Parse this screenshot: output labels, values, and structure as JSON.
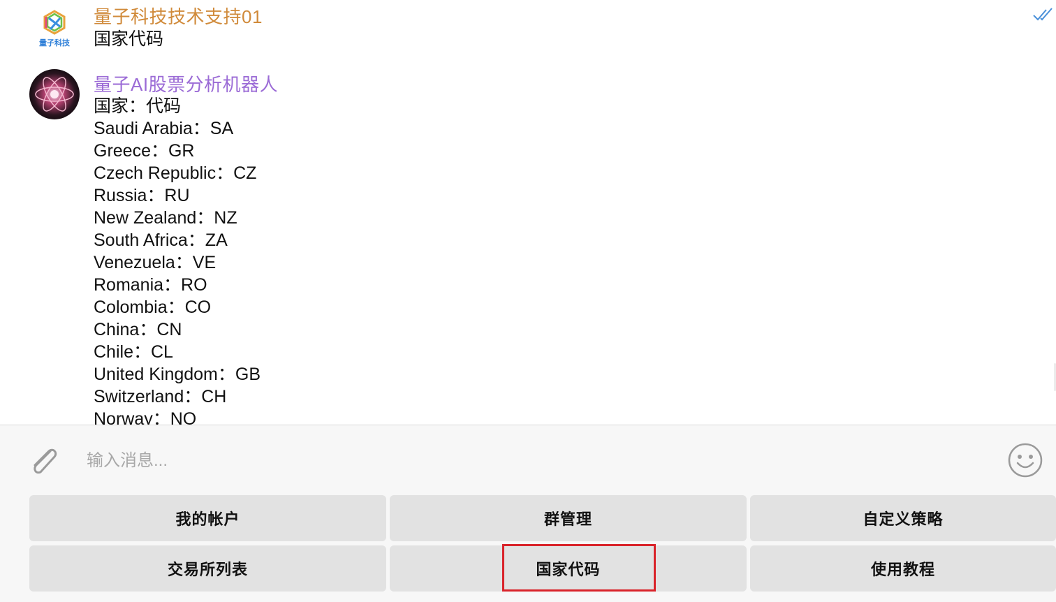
{
  "messages": [
    {
      "sender": "量子科技技术支持01",
      "text": "国家代码",
      "avatar_label": "量子科技",
      "status": "read"
    },
    {
      "sender": "量子AI股票分析机器人",
      "lines": [
        "国家：代码",
        "Saudi Arabia：SA",
        "Greece：GR",
        "Czech Republic：CZ",
        "Russia：RU",
        "New Zealand：NZ",
        "South Africa：ZA",
        "Venezuela：VE",
        "Romania：RO",
        "Colombia：CO",
        "China：CN",
        "Chile：CL",
        "United Kingdom：GB",
        "Switzerland：CH",
        "Norway：NO"
      ]
    }
  ],
  "composer": {
    "placeholder": "输入消息...",
    "attach_icon": "paperclip-icon",
    "emoji_icon": "smiley-icon"
  },
  "keyboard": {
    "rows": [
      [
        "我的帐户",
        "群管理",
        "自定义策略"
      ],
      [
        "交易所列表",
        "国家代码",
        "使用教程"
      ]
    ],
    "highlighted": "国家代码",
    "highlight_color": "#d9232a"
  },
  "colors": {
    "sender1": "#d08a3a",
    "sender2": "#9b6bd6",
    "tick": "#4a90d9"
  }
}
